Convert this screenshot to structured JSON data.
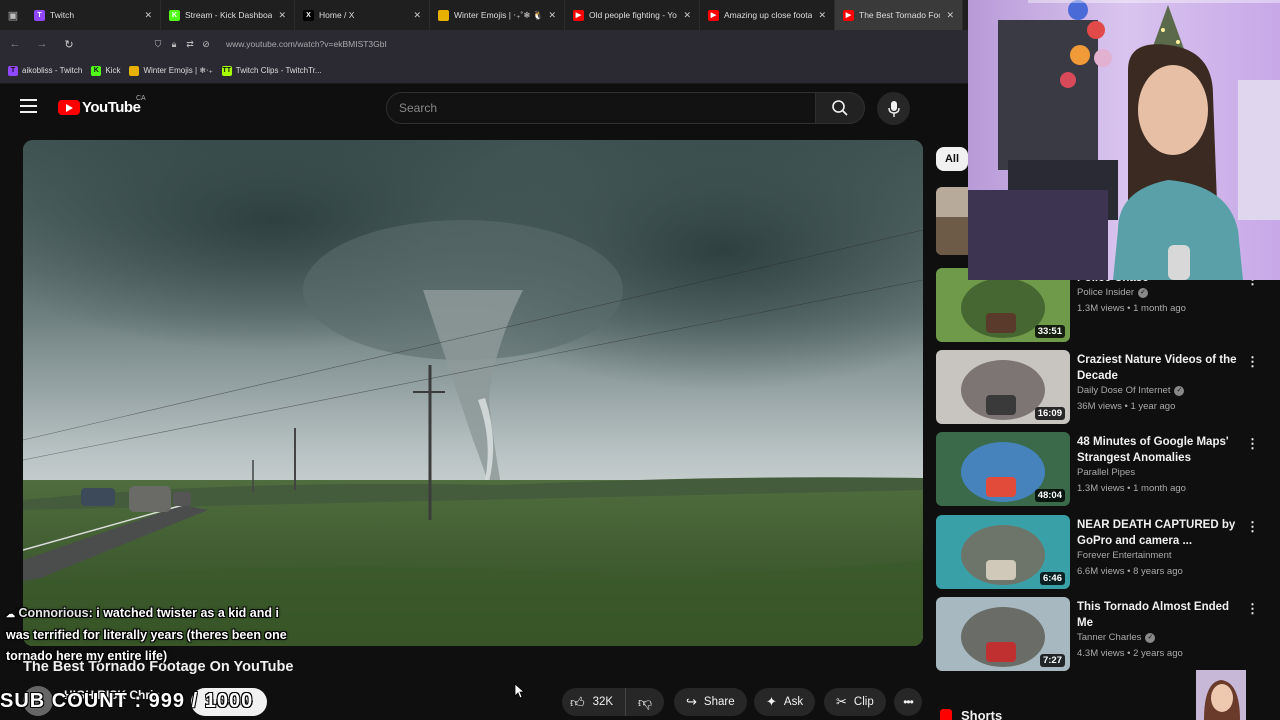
{
  "browser": {
    "tabs": [
      {
        "label": "Twitch",
        "fav_color": "#9146ff",
        "fav_glyph": "T"
      },
      {
        "label": "Stream - Kick Dashboard",
        "fav_color": "#53fc18",
        "fav_glyph": "K"
      },
      {
        "label": "Home / X",
        "fav_color": "#000000",
        "fav_glyph": "X"
      },
      {
        "label": "Winter Emojis | ‧₊˚❄ 🐧*˚‧₊",
        "fav_color": "#e8b100",
        "fav_glyph": ""
      },
      {
        "label": "Old people fighting - YouTube",
        "fav_color": "#ff0000",
        "fav_glyph": "▶"
      },
      {
        "label": "Amazing up close footage",
        "fav_color": "#ff0000",
        "fav_glyph": "▶"
      },
      {
        "label": "The Best Tornado Footage",
        "fav_color": "#ff0000",
        "fav_glyph": "▶"
      }
    ],
    "url": "www.youtube.com/watch?v=ekBMIST3GbI",
    "bookmarks": [
      {
        "label": "aikobliss - Twitch",
        "fav_color": "#9146ff",
        "fav_glyph": "T"
      },
      {
        "label": "Kick",
        "fav_color": "#53fc18",
        "fav_glyph": "K"
      },
      {
        "label": "Winter Emojis | ❄‧₊",
        "fav_color": "#e8b100",
        "fav_glyph": ""
      },
      {
        "label": "Twitch Clips - TwitchTr...",
        "fav_color": "#a5ff00",
        "fav_glyph": "TT"
      }
    ]
  },
  "youtube": {
    "logo_text": "YouTube",
    "country": "CA",
    "search_placeholder": "Search",
    "video": {
      "title": "The Best Tornado Footage On YouTube",
      "channel": "HIGH RISK Chris",
      "subscribe_label": "Subscribe",
      "like_count": "32K",
      "share_label": "Share",
      "ask_label": "Ask",
      "clip_label": "Clip"
    },
    "chip_all": "All",
    "recommendations": [
      {
        "title": "Police Chase",
        "channel": "Police Insider",
        "meta": "1.3M views • 1 month ago",
        "duration": "33:51",
        "verified": true
      },
      {
        "title": "Craziest Nature Videos of the Decade",
        "channel": "Daily Dose Of Internet",
        "meta": "36M views • 1 year ago",
        "duration": "16:09",
        "verified": true
      },
      {
        "title": "48 Minutes of Google Maps' Strangest Anomalies",
        "channel": "Parallel Pipes",
        "meta": "1.3M views • 1 month ago",
        "duration": "48:04",
        "verified": false
      },
      {
        "title": "NEAR DEATH CAPTURED by GoPro and camera ...",
        "channel": "Forever Entertainment",
        "meta": "6.6M views • 8 years ago",
        "duration": "6:46",
        "verified": false
      },
      {
        "title": "This Tornado Almost Ended Me",
        "channel": "Tanner Charles",
        "meta": "4.3M views • 2 years ago",
        "duration": "7:27",
        "verified": true
      }
    ],
    "shorts_label": "Shorts"
  },
  "overlay": {
    "chat_user": "Connorious",
    "chat_message": "i watched twister as a kid and i was terrified for literally years (theres been one tornado here my entire life)",
    "sub_count": "SUB COUNT : 999 / 1000"
  },
  "colors": {
    "accent": "#ff0000",
    "bg": "#0f0f0f"
  }
}
